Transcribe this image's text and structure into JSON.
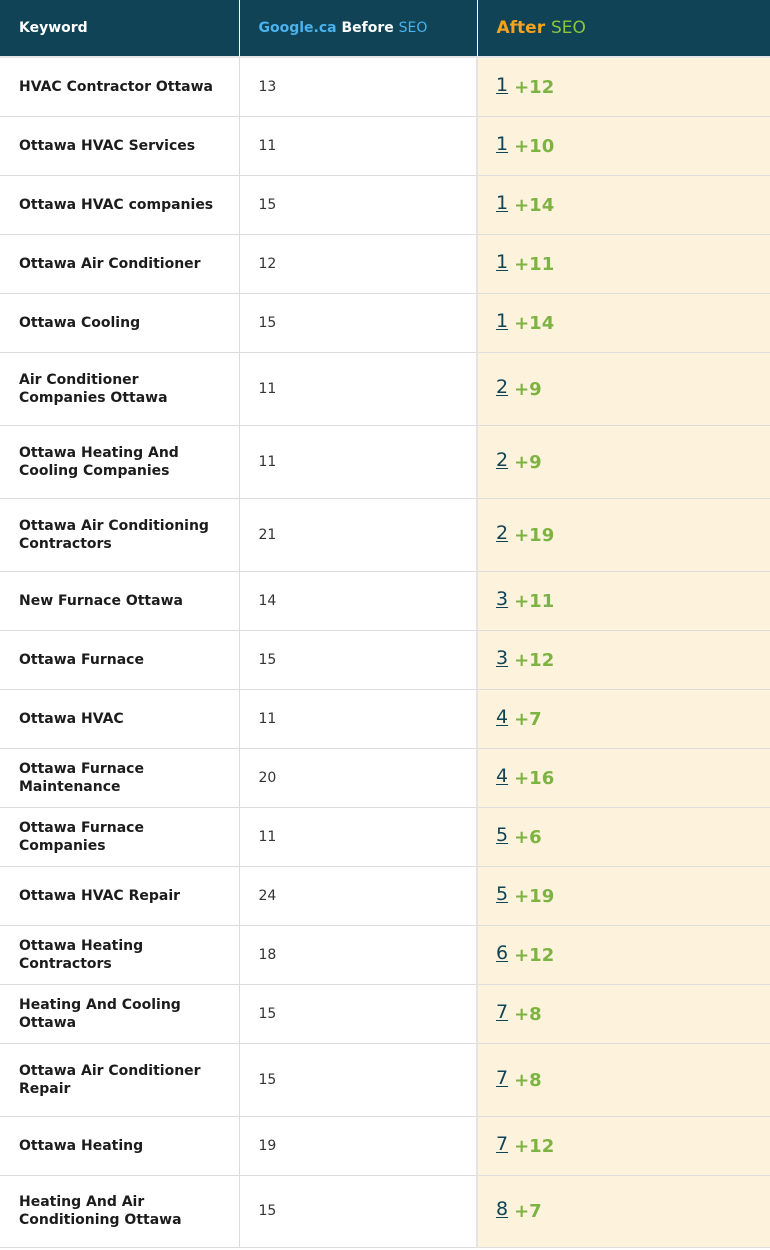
{
  "header": {
    "keyword": "Keyword",
    "google": "Google.ca",
    "before": "Before",
    "seo_blue": "SEO",
    "after": "After",
    "seo_green": "SEO"
  },
  "colors": {
    "header_bg": "#0f4355",
    "google_blue": "#4ab3ee",
    "after_orange": "#f3a31f",
    "seo_green": "#8cc63f",
    "delta_green": "#7cb342",
    "after_col_bg": "#fdf2dc"
  },
  "rows": [
    {
      "keyword": "HVAC Contractor Ottawa",
      "before": "13",
      "after": "1",
      "delta": "+12"
    },
    {
      "keyword": "Ottawa HVAC Services",
      "before": "11",
      "after": "1",
      "delta": "+10"
    },
    {
      "keyword": "Ottawa HVAC companies",
      "before": "15",
      "after": "1",
      "delta": "+14"
    },
    {
      "keyword": "Ottawa Air Conditioner",
      "before": "12",
      "after": "1",
      "delta": "+11"
    },
    {
      "keyword": "Ottawa Cooling",
      "before": "15",
      "after": "1",
      "delta": "+14"
    },
    {
      "keyword": "Air Conditioner Companies Ottawa",
      "before": "11",
      "after": "2",
      "delta": "+9"
    },
    {
      "keyword": "Ottawa Heating And Cooling Companies",
      "before": "11",
      "after": "2",
      "delta": "+9"
    },
    {
      "keyword": "Ottawa Air Conditioning Contractors",
      "before": "21",
      "after": "2",
      "delta": "+19"
    },
    {
      "keyword": "New Furnace Ottawa",
      "before": "14",
      "after": "3",
      "delta": "+11"
    },
    {
      "keyword": "Ottawa Furnace",
      "before": "15",
      "after": "3",
      "delta": "+12"
    },
    {
      "keyword": "Ottawa HVAC",
      "before": "11",
      "after": "4",
      "delta": "+7"
    },
    {
      "keyword": "Ottawa Furnace Maintenance",
      "before": "20",
      "after": "4",
      "delta": "+16"
    },
    {
      "keyword": "Ottawa Furnace Companies",
      "before": "11",
      "after": "5",
      "delta": "+6"
    },
    {
      "keyword": "Ottawa HVAC Repair",
      "before": "24",
      "after": "5",
      "delta": "+19"
    },
    {
      "keyword": "Ottawa Heating Contractors",
      "before": "18",
      "after": "6",
      "delta": "+12"
    },
    {
      "keyword": "Heating And Cooling Ottawa",
      "before": "15",
      "after": "7",
      "delta": "+8"
    },
    {
      "keyword": "Ottawa Air Conditioner Repair",
      "before": "15",
      "after": "7",
      "delta": "+8"
    },
    {
      "keyword": "Ottawa Heating",
      "before": "19",
      "after": "7",
      "delta": "+12"
    },
    {
      "keyword": "Heating And Air Conditioning Ottawa",
      "before": "15",
      "after": "8",
      "delta": "+7"
    }
  ]
}
